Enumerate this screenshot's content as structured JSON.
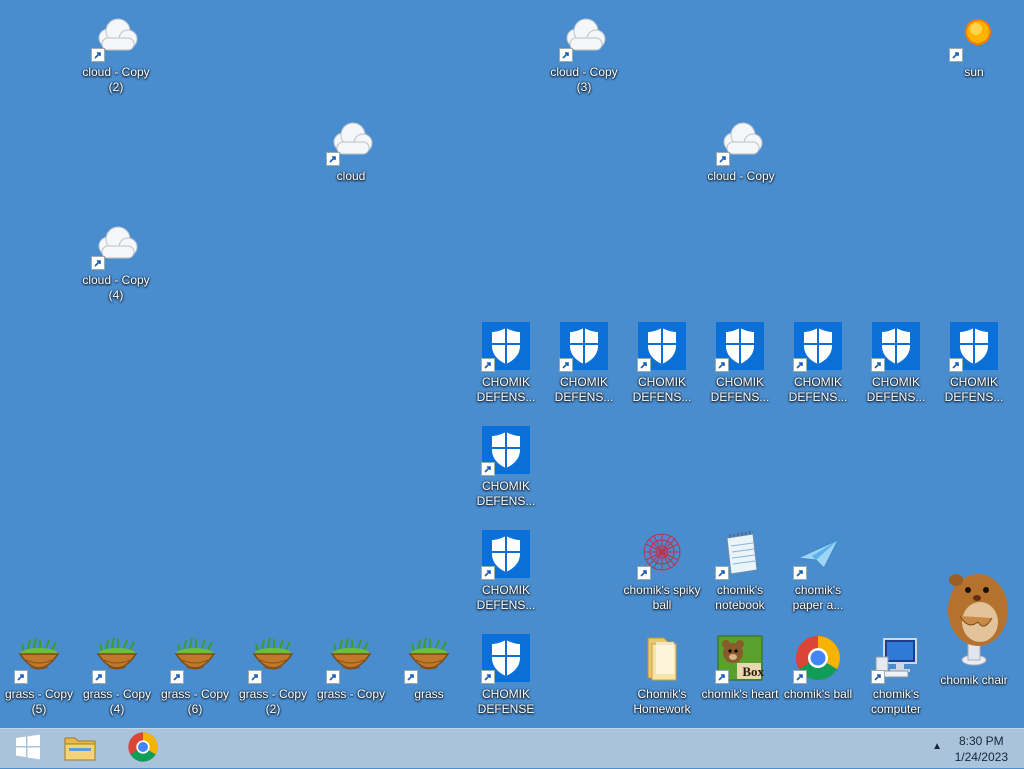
{
  "desktop": {
    "clouds": [
      {
        "label": "cloud - Copy (2)"
      },
      {
        "label": "cloud - Copy (3)"
      },
      {
        "label": "cloud"
      },
      {
        "label": "cloud - Copy"
      },
      {
        "label": "cloud - Copy (4)"
      }
    ],
    "sun": {
      "label": "sun"
    },
    "defenders": [
      {
        "label": "CHOMIK DEFENS..."
      },
      {
        "label": "CHOMIK DEFENS..."
      },
      {
        "label": "CHOMIK DEFENS..."
      },
      {
        "label": "CHOMIK DEFENS..."
      },
      {
        "label": "CHOMIK DEFENS..."
      },
      {
        "label": "CHOMIK DEFENS..."
      },
      {
        "label": "CHOMIK DEFENS..."
      },
      {
        "label": "CHOMIK DEFENS..."
      },
      {
        "label": "CHOMIK DEFENS..."
      },
      {
        "label": "CHOMIK DEFENSE"
      }
    ],
    "grass": [
      {
        "label": "grass - Copy (5)"
      },
      {
        "label": "grass - Copy (4)"
      },
      {
        "label": "grass - Copy (6)"
      },
      {
        "label": "grass - Copy (2)"
      },
      {
        "label": "grass - Copy"
      },
      {
        "label": "grass"
      }
    ],
    "misc": [
      {
        "label": "chomik's spiky ball",
        "icon": "spiky-ball-icon"
      },
      {
        "label": "chomik's notebook",
        "icon": "notepad-icon"
      },
      {
        "label": "chomik's paper a...",
        "icon": "paper-airplane-icon"
      },
      {
        "label": "Chomik's Homework",
        "icon": "folder-icon"
      },
      {
        "label": "chomik's heart",
        "icon": "bear-box-icon",
        "box_text": "Box"
      },
      {
        "label": "chomik's ball",
        "icon": "chrome-icon"
      },
      {
        "label": "chomik's computer",
        "icon": "computer-icon"
      },
      {
        "label": "chomik chair",
        "icon": "hamster-icon"
      }
    ]
  },
  "taskbar": {
    "start": {
      "icon": "windows-logo-icon"
    },
    "pinned": [
      {
        "icon": "file-explorer-icon"
      },
      {
        "icon": "chrome-icon"
      }
    ],
    "tray_chevron": "▲",
    "clock": {
      "time": "8:30 PM",
      "date": "1/24/2023"
    }
  },
  "colors": {
    "desktop_bg": "#4a8dce",
    "taskbar_bg": "#a9c3dd",
    "defender_blue": "#0a6fd6"
  }
}
